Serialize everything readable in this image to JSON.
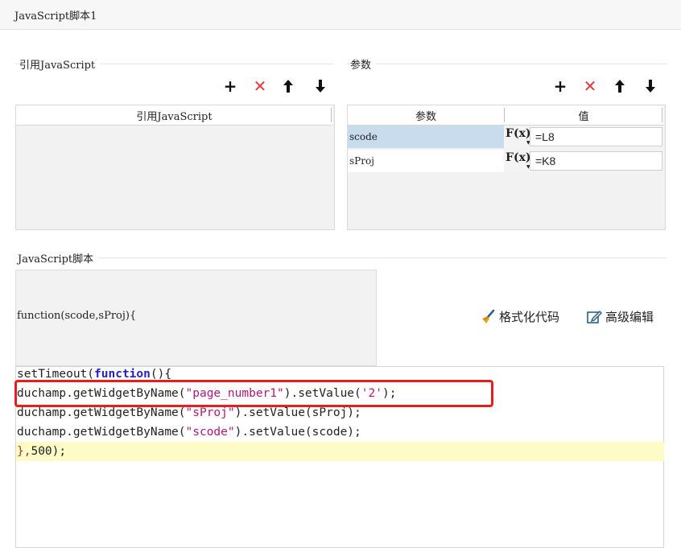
{
  "window": {
    "title": "JavaScript脚本1"
  },
  "ref_js": {
    "section_label": "引用JavaScript",
    "column_header": "引用JavaScript",
    "toolbar": {
      "add": "+",
      "delete": "✕",
      "up": "🡑",
      "down": "🡓"
    }
  },
  "params": {
    "section_label": "参数",
    "toolbar": {
      "add": "+",
      "delete": "✕",
      "up": "🡑",
      "down": "🡓"
    },
    "columns": {
      "name": "参数",
      "value": "值"
    },
    "rows": [
      {
        "name": "scode",
        "fx": "F(x)",
        "value": "=L8"
      },
      {
        "name": "sProj",
        "fx": "F(x)",
        "value": "=K8"
      }
    ]
  },
  "script": {
    "section_label": "JavaScript脚本",
    "signature": "function(scode,sProj){",
    "format_label": "格式化代码",
    "advanced_label": "高级编辑",
    "code_lines": [
      {
        "pre": "setTimeout(",
        "kw": "function",
        "post": "(){"
      },
      {
        "a": "duchamp.getWidgetByName(",
        "s1": "\"page_number1\"",
        "b": ").setValue(",
        "s2": "'2'",
        "c": ");"
      },
      {
        "a": "duchamp.getWidgetByName(",
        "s1": "\"sProj\"",
        "b": ").setValue(sProj);"
      },
      {
        "a": "duchamp.getWidgetByName(",
        "s1": "\"scode\"",
        "b": ").setValue(scode);"
      },
      {
        "a": "},",
        "n": "500",
        "b": ");"
      }
    ]
  }
}
